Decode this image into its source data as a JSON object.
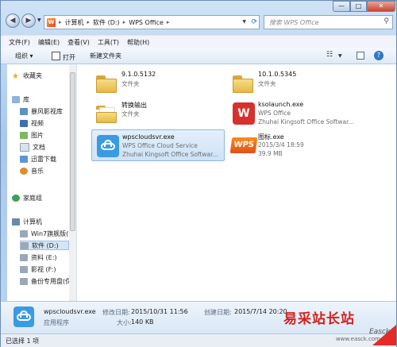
{
  "address": {
    "crumbs": [
      "计算机",
      "软件 (D:)",
      "WPS Office"
    ],
    "separator": "▸"
  },
  "search": {
    "placeholder": "搜索 WPS Office"
  },
  "window_controls": {
    "min": "—",
    "max": "□",
    "close": "✕"
  },
  "menu": [
    "文件(F)",
    "编辑(E)",
    "查看(V)",
    "工具(T)",
    "帮助(H)"
  ],
  "toolbar": {
    "organize": "组织 ▾",
    "open": "打开",
    "new_folder": "新建文件夹",
    "help": "?"
  },
  "nav": {
    "favorites": "收藏夹",
    "library": "库",
    "library_items": [
      "暴风影视库",
      "视频",
      "图片",
      "文档",
      "迅雷下载",
      "音乐"
    ],
    "homegroup": "家庭组",
    "computer": "计算机",
    "drives": [
      "Win7旗舰版(本",
      "软件 (D:)",
      "资料 (E:)",
      "影视 (F:)",
      "备份专用盘(保"
    ]
  },
  "files": [
    {
      "name": "9.1.0.5132",
      "line2": "文件夹",
      "line3": ""
    },
    {
      "name": "10.1.0.5345",
      "line2": "文件夹",
      "line3": ""
    },
    {
      "name": "转换输出",
      "line2": "文件夹",
      "line3": ""
    },
    {
      "name": "ksolaunch.exe",
      "line2": "WPS Office",
      "line3": "Zhuhai Kingsoft Office Softwar..."
    },
    {
      "name": "wpscloudsvr.exe",
      "line2": "WPS Office Cloud Service",
      "line3": "Zhuhai Kingsoft Office Softwar..."
    },
    {
      "name": "图标.exe",
      "line2": "2015/3/4 18:59",
      "line3": "39.9 MB"
    }
  ],
  "details": {
    "name": "wpscloudsvr.exe",
    "type": "应用程序",
    "modified_label": "修改日期:",
    "modified": "2015/10/31 11:56",
    "created_label": "创建日期:",
    "created": "2015/7/14 20:20",
    "size_label": "大小:",
    "size": "140 KB"
  },
  "status": "已选择 1 项",
  "watermark": {
    "text": "易采站长站",
    "sub": "Easck",
    "url": "www.easck.com"
  },
  "colors": {
    "accent": "#3a9be4",
    "selection": "#cde2f7",
    "wps_red": "#d8302c"
  }
}
